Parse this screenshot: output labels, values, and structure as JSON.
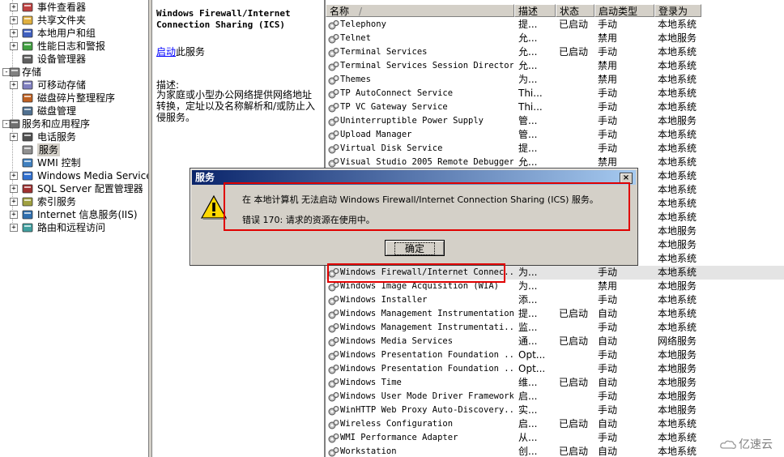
{
  "tree": {
    "items": [
      {
        "label": "事件查看器",
        "level": 1,
        "expander": "+",
        "icon": "event-viewer-icon"
      },
      {
        "label": "共享文件夹",
        "level": 1,
        "expander": "+",
        "icon": "shared-folder-icon"
      },
      {
        "label": "本地用户和组",
        "level": 1,
        "expander": "+",
        "icon": "users-icon"
      },
      {
        "label": "性能日志和警报",
        "level": 1,
        "expander": "+",
        "icon": "performance-icon"
      },
      {
        "label": "设备管理器",
        "level": 1,
        "expander": "",
        "icon": "device-manager-icon"
      },
      {
        "label": "存储",
        "level": 0,
        "expander": "-",
        "icon": "storage-icon"
      },
      {
        "label": "可移动存储",
        "level": 1,
        "expander": "+",
        "icon": "removable-storage-icon"
      },
      {
        "label": "磁盘碎片整理程序",
        "level": 1,
        "expander": "",
        "icon": "defrag-icon"
      },
      {
        "label": "磁盘管理",
        "level": 1,
        "expander": "",
        "icon": "disk-management-icon"
      },
      {
        "label": "服务和应用程序",
        "level": 0,
        "expander": "-",
        "icon": "services-apps-icon"
      },
      {
        "label": "电话服务",
        "level": 1,
        "expander": "+",
        "icon": "telephony-icon"
      },
      {
        "label": "服务",
        "level": 1,
        "expander": "",
        "icon": "services-icon",
        "selected": true
      },
      {
        "label": "WMI 控制",
        "level": 1,
        "expander": "",
        "icon": "wmi-icon"
      },
      {
        "label": "Windows Media Services",
        "level": 1,
        "expander": "+",
        "icon": "media-services-icon"
      },
      {
        "label": "SQL Server 配置管理器",
        "level": 1,
        "expander": "+",
        "icon": "sql-server-icon"
      },
      {
        "label": "索引服务",
        "level": 1,
        "expander": "+",
        "icon": "index-service-icon"
      },
      {
        "label": "Internet 信息服务(IIS)",
        "level": 1,
        "expander": "+",
        "icon": "iis-icon"
      },
      {
        "label": "路由和远程访问",
        "level": 1,
        "expander": "+",
        "icon": "routing-icon"
      }
    ]
  },
  "description": {
    "title": "Windows Firewall/Internet Connection Sharing (ICS)",
    "start_link": "启动",
    "start_suffix": "此服务",
    "label": "描述:",
    "text": "为家庭或小型办公网络提供网络地址转换，定址以及名称解析和/或防止入侵服务。"
  },
  "list": {
    "headers": {
      "name": "名称",
      "desc": "描述",
      "status": "状态",
      "startup": "启动类型",
      "logon": "登录为"
    },
    "sort_indicator": "/",
    "rows": [
      {
        "name": "Telephony",
        "desc": "提...",
        "status": "已启动",
        "startup": "手动",
        "logon": "本地系统"
      },
      {
        "name": "Telnet",
        "desc": "允...",
        "status": "",
        "startup": "禁用",
        "logon": "本地服务"
      },
      {
        "name": "Terminal Services",
        "desc": "允...",
        "status": "已启动",
        "startup": "手动",
        "logon": "本地系统"
      },
      {
        "name": "Terminal Services Session Directory",
        "desc": "允...",
        "status": "",
        "startup": "禁用",
        "logon": "本地系统"
      },
      {
        "name": "Themes",
        "desc": "为...",
        "status": "",
        "startup": "禁用",
        "logon": "本地系统"
      },
      {
        "name": "TP AutoConnect Service",
        "desc": "Thi...",
        "status": "",
        "startup": "手动",
        "logon": "本地系统"
      },
      {
        "name": "TP VC Gateway Service",
        "desc": "Thi...",
        "status": "",
        "startup": "手动",
        "logon": "本地系统"
      },
      {
        "name": "Uninterruptible Power Supply",
        "desc": "管...",
        "status": "",
        "startup": "手动",
        "logon": "本地服务"
      },
      {
        "name": "Upload Manager",
        "desc": "管...",
        "status": "",
        "startup": "手动",
        "logon": "本地系统"
      },
      {
        "name": "Virtual Disk Service",
        "desc": "提...",
        "status": "",
        "startup": "手动",
        "logon": "本地系统"
      },
      {
        "name": "Visual Studio 2005 Remote Debugger",
        "desc": "允...",
        "status": "",
        "startup": "禁用",
        "logon": "本地系统"
      },
      {
        "name": "",
        "desc": "",
        "status": "",
        "startup": "",
        "logon": "本地系统"
      },
      {
        "name": "",
        "desc": "",
        "status": "",
        "startup": "",
        "logon": "本地系统"
      },
      {
        "name": "",
        "desc": "",
        "status": "",
        "startup": "",
        "logon": "本地系统"
      },
      {
        "name": "",
        "desc": "",
        "status": "",
        "startup": "",
        "logon": "本地系统"
      },
      {
        "name": "",
        "desc": "",
        "status": "",
        "startup": "",
        "logon": "本地服务"
      },
      {
        "name": "",
        "desc": "",
        "status": "",
        "startup": "",
        "logon": "本地服务"
      },
      {
        "name": "",
        "desc": "",
        "status": "",
        "startup": "",
        "logon": "本地系统"
      },
      {
        "name": "Windows Firewall/Internet Connec...",
        "desc": "为...",
        "status": "",
        "startup": "手动",
        "logon": "本地系统",
        "selected": true
      },
      {
        "name": "Windows Image Acquisition (WIA)",
        "desc": "为...",
        "status": "",
        "startup": "禁用",
        "logon": "本地服务"
      },
      {
        "name": "Windows Installer",
        "desc": "添...",
        "status": "",
        "startup": "手动",
        "logon": "本地系统"
      },
      {
        "name": "Windows Management Instrumentation",
        "desc": "提...",
        "status": "已启动",
        "startup": "自动",
        "logon": "本地系统"
      },
      {
        "name": "Windows Management Instrumentati...",
        "desc": "监...",
        "status": "",
        "startup": "手动",
        "logon": "本地系统"
      },
      {
        "name": "Windows Media Services",
        "desc": "通...",
        "status": "已启动",
        "startup": "自动",
        "logon": "网络服务"
      },
      {
        "name": "Windows Presentation Foundation ...",
        "desc": "Opt...",
        "status": "",
        "startup": "手动",
        "logon": "本地服务"
      },
      {
        "name": "Windows Presentation Foundation ...",
        "desc": "Opt...",
        "status": "",
        "startup": "手动",
        "logon": "本地服务"
      },
      {
        "name": "Windows Time",
        "desc": "维...",
        "status": "已启动",
        "startup": "自动",
        "logon": "本地服务"
      },
      {
        "name": "Windows User Mode Driver Framework",
        "desc": "启...",
        "status": "",
        "startup": "手动",
        "logon": "本地服务"
      },
      {
        "name": "WinHTTP Web Proxy Auto-Discovery...",
        "desc": "实...",
        "status": "",
        "startup": "手动",
        "logon": "本地服务"
      },
      {
        "name": "Wireless Configuration",
        "desc": "启...",
        "status": "已启动",
        "startup": "自动",
        "logon": "本地系统"
      },
      {
        "name": "WMI Performance Adapter",
        "desc": "从...",
        "status": "",
        "startup": "手动",
        "logon": "本地系统"
      },
      {
        "name": "Workstation",
        "desc": "创...",
        "status": "已启动",
        "startup": "自动",
        "logon": "本地系统"
      }
    ]
  },
  "dialog": {
    "title": "服务",
    "close": "×",
    "message1": "在 本地计算机 无法启动 Windows Firewall/Internet Connection Sharing (ICS) 服务。",
    "message2": "错误 170: 请求的资源在使用中。",
    "ok": "确定"
  },
  "watermark": {
    "text": "亿速云"
  },
  "colors": {
    "highlight": "#e00000",
    "titlebar": "#0a246a",
    "link": "#0000ff",
    "face": "#d4d0c8"
  }
}
